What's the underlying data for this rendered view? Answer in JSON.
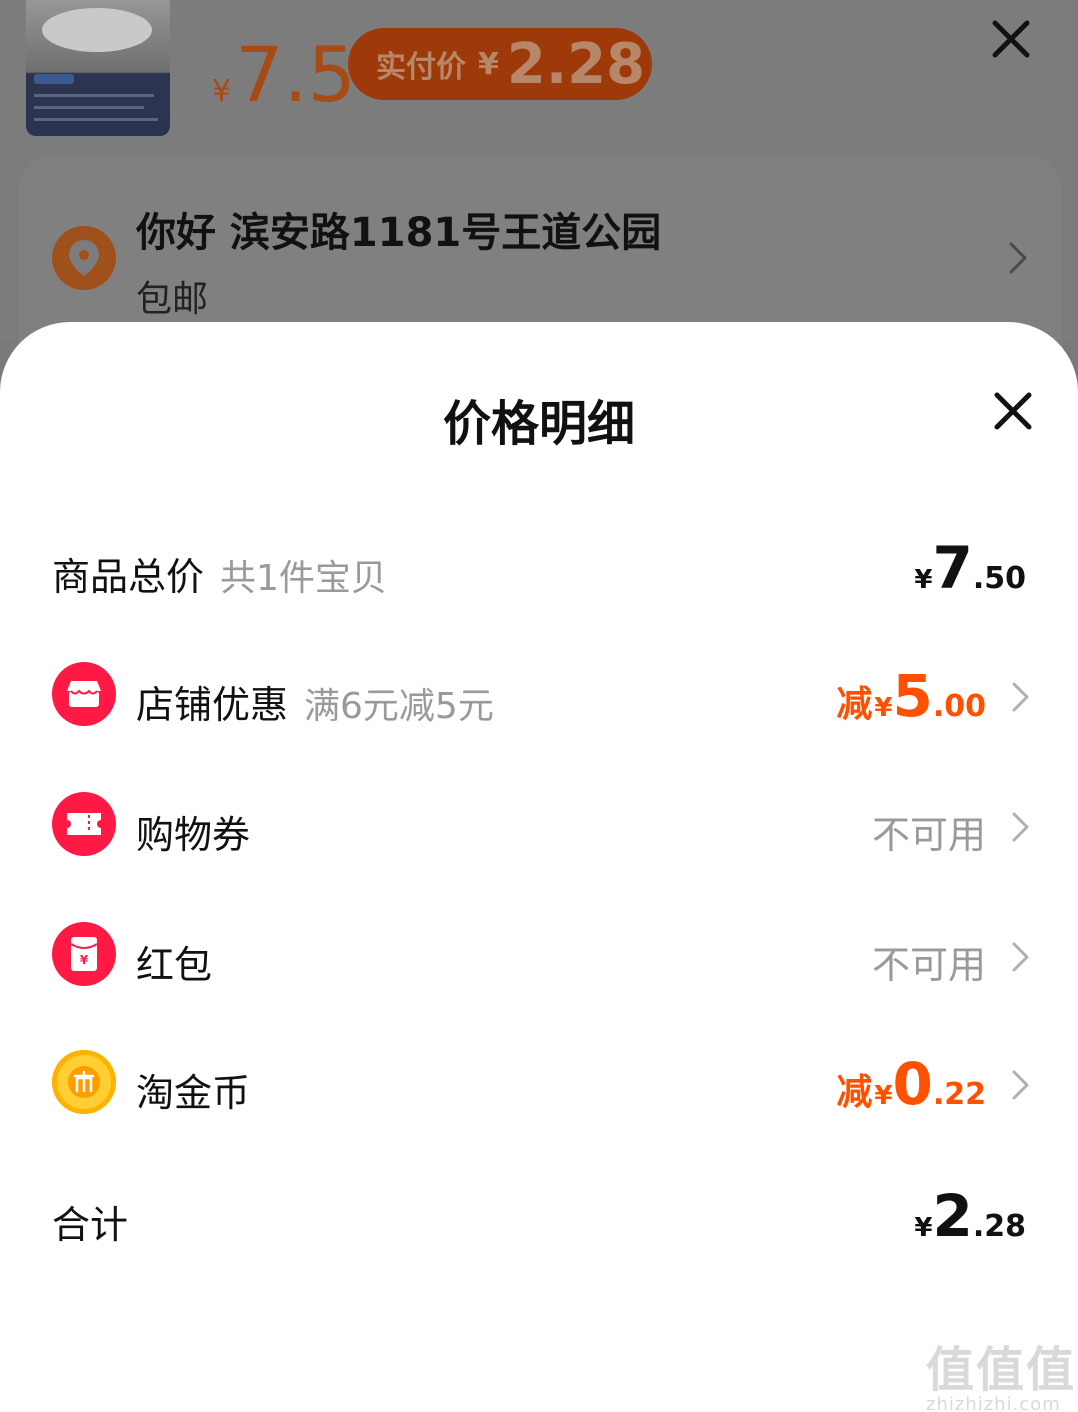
{
  "product": {
    "price_yen": "¥",
    "price": "7.5",
    "pay_pill": {
      "label": "实付价",
      "yen": "¥",
      "value": "2.28"
    }
  },
  "address": {
    "name_line": "你好 滨安路1181号王道公园",
    "shipping": "包邮"
  },
  "sheet": {
    "title": "价格明细",
    "rows": {
      "total_goods": {
        "label": "商品总价",
        "sub": "共1件宝贝",
        "yen": "¥",
        "int": "7",
        "dec": ".50"
      },
      "shop_discount": {
        "label": "店铺优惠",
        "sub": "满6元减5元",
        "prefix": "减",
        "yen": "¥",
        "int": "5",
        "dec": ".00"
      },
      "coupon": {
        "label": "购物券",
        "status": "不可用"
      },
      "red_packet": {
        "label": "红包",
        "status": "不可用"
      },
      "coins": {
        "label": "淘金币",
        "prefix": "减",
        "yen": "¥",
        "int": "0",
        "dec": ".22"
      },
      "sum": {
        "label": "合计",
        "yen": "¥",
        "int": "2",
        "dec": ".28"
      }
    }
  },
  "watermark": {
    "big": "值值值",
    "small": "zhizhizhi.com"
  },
  "colors": {
    "accent": "#ff5000",
    "icon_red": "#ff1a45",
    "coin_gold": "#ffb300"
  },
  "icons": [
    "close-icon",
    "location-pin-icon",
    "chevron-right-icon",
    "shop-icon",
    "ticket-icon",
    "red-packet-icon",
    "coin-icon"
  ]
}
